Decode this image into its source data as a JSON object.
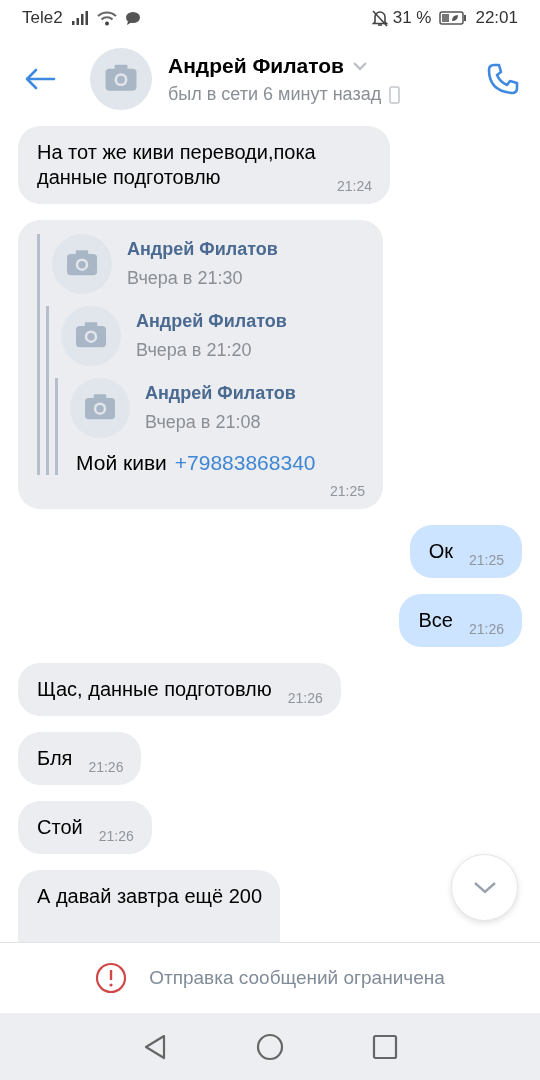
{
  "status_bar": {
    "carrier": "Tele2",
    "battery": "31 %",
    "clock": "22:01"
  },
  "header": {
    "name": "Андрей Филатов",
    "status": "был в сети 6 минут назад"
  },
  "messages": [
    {
      "kind": "text",
      "outgoing": false,
      "text": "На тот же киви переводи,пока данные подготовлю",
      "time": "21:24"
    },
    {
      "kind": "forward",
      "outgoing": false,
      "time": "21:25",
      "children": [
        {
          "author": "Андрей Филатов",
          "date": "Вчера в 21:30",
          "children": [
            {
              "author": "Андрей Филатов",
              "date": "Вчера в 21:20",
              "children": [
                {
                  "author": "Андрей Филатов",
                  "date": "Вчера в 21:08",
                  "text": "Мой киви",
                  "link": "+79883868340"
                }
              ]
            }
          ]
        }
      ]
    },
    {
      "kind": "text",
      "outgoing": true,
      "text": "Ок",
      "time": "21:25"
    },
    {
      "kind": "text",
      "outgoing": true,
      "text": "Все",
      "time": "21:26"
    },
    {
      "kind": "text",
      "outgoing": false,
      "text": "Щас, данные подготовлю",
      "time": "21:26"
    },
    {
      "kind": "text",
      "outgoing": false,
      "text": "Бля",
      "time": "21:26"
    },
    {
      "kind": "text",
      "outgoing": false,
      "text": "Стой",
      "time": "21:26"
    },
    {
      "kind": "text",
      "outgoing": false,
      "text": "А давай завтра ещё 200"
    }
  ],
  "notice": "Отправка сообщений ограничена"
}
